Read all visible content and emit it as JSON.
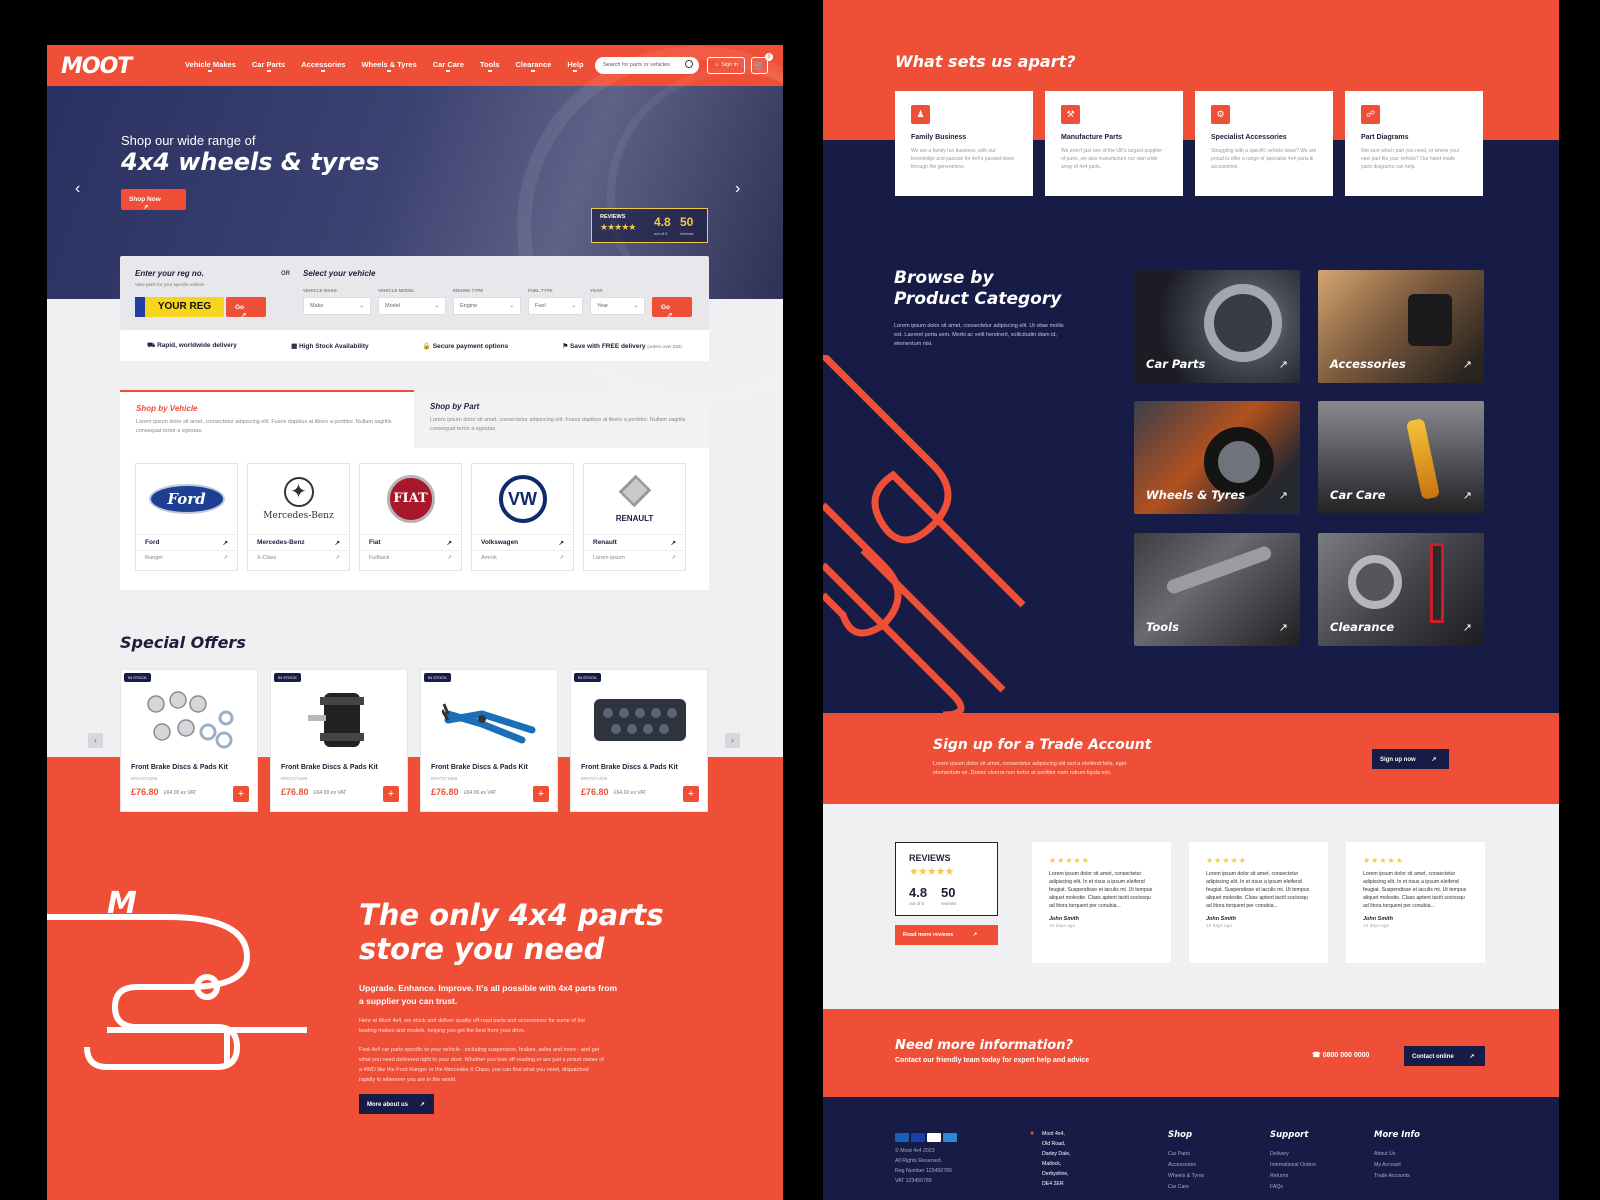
{
  "header": {
    "logo": "MOOT",
    "nav": [
      "Vehicle Makes",
      "Car Parts",
      "Accessories",
      "Wheels & Tyres",
      "Car Care",
      "Tools",
      "Clearance",
      "Help"
    ],
    "search_placeholder": "Search for parts or vehicles",
    "signin": "Sign in",
    "cart_count": "0"
  },
  "hero": {
    "line1": "Shop our wide range of",
    "line2": "4x4 wheels & tyres",
    "cta": "Shop Now",
    "reviews_brand": "REVIEWS",
    "rating": "4.8",
    "rating_sub": "out of 5",
    "review_count": "50",
    "review_count_sub": "reviews"
  },
  "search": {
    "reg_label": "Enter your reg no.",
    "reg_sub": "View parts for your specific vehicle",
    "reg_plate": "YOUR REG",
    "go": "Go",
    "or": "OR",
    "vehicle_label": "Select your vehicle",
    "fields": [
      {
        "label": "VEHICLE MAKE",
        "value": "Make"
      },
      {
        "label": "VEHICLE MODEL",
        "value": "Model"
      },
      {
        "label": "ENGINE TYPE",
        "value": "Engine"
      },
      {
        "label": "FUEL TYPE",
        "value": "Fuel"
      },
      {
        "label": "YEAR",
        "value": "Year"
      }
    ]
  },
  "benefits": [
    "Rapid, worldwide delivery",
    "High Stock Availability",
    "Secure payment options",
    "Save with FREE delivery"
  ],
  "benefits_note": "(orders over £50)",
  "shop_tabs": [
    {
      "title": "Shop by Vehicle",
      "desc": "Lorem ipsum dolor sit amet, consectetur adipiscing elit. Fusce dapibus at libero a porttitor. Nullam sagittis consequat tortor a egestas."
    },
    {
      "title": "Shop by Part",
      "desc": "Lorem ipsum dolor sit amet, consectetur adipiscing elit. Fusce dapibus at libero a porttitor. Nullam sagittis consequat tortor a egestas."
    }
  ],
  "brands": [
    {
      "name": "Ford",
      "model": "Ranger",
      "logo": "Ford"
    },
    {
      "name": "Mercedes-Benz",
      "model": "X-Class",
      "logo": "Mercedes-Benz"
    },
    {
      "name": "Fiat",
      "model": "Fullback",
      "logo": "FIAT"
    },
    {
      "name": "Volkswagen",
      "model": "Amrok",
      "logo": "VW"
    },
    {
      "name": "Renault",
      "model": "Lorem ipsum",
      "logo": "RENAULT"
    }
  ],
  "special_offers": {
    "title": "Special Offers",
    "badge": "IN STOCK",
    "items": [
      {
        "title": "Front Brake Discs & Pads Kit",
        "sku": "BR07871096",
        "price": "£76.80",
        "ex_vat": "£64.00 ex VAT"
      },
      {
        "title": "Front Brake Discs & Pads Kit",
        "sku": "BR07871096",
        "price": "£76.80",
        "ex_vat": "£64.00 ex VAT"
      },
      {
        "title": "Front Brake Discs & Pads Kit",
        "sku": "BR07871096",
        "price": "£76.80",
        "ex_vat": "£64.00 ex VAT"
      },
      {
        "title": "Front Brake Discs & Pads Kit",
        "sku": "BR07871096",
        "price": "£76.80",
        "ex_vat": "£64.00 ex VAT"
      }
    ]
  },
  "about": {
    "title": "The only 4x4 parts store you need",
    "lead": "Upgrade. Enhance. Improve. It's all possible with 4x4 parts from a supplier you can trust.",
    "p1": "Here at Moot 4x4, we stock and deliver quality off-road parts and accessories for some of the leading makes and models, helping you get the best from your drive.",
    "p2": "Find 4x4 car parts specific to your vehicle - including suspension, brakes, axles and more - and get what you need delivered right to your door. Whether you love off-roading or are just a proud owner of a 4WD like the Ford Ranger or the Mercedes X Class, you can find what you need, dispatched rapidly to wherever you are in the world.",
    "cta": "More about us"
  },
  "apart": {
    "title": "What sets us apart?",
    "items": [
      {
        "title": "Family Business",
        "desc": "We are a family run business, with our knowledge and passion for 4x4's passed down through the generations."
      },
      {
        "title": "Manufacture Parts",
        "desc": "We aren't just one of the UK's largest supplier of parts, we also manufacture our own wide array of 4x4 parts."
      },
      {
        "title": "Specialist Accessories",
        "desc": "Struggling with a specific vehicle issue? We are proud to offer a range of specialist 4x4 parts & accessories."
      },
      {
        "title": "Part Diagrams",
        "desc": "Not sure which part you need, or where your new part fits your vehicle? Our hand-made parts diagrams can help."
      }
    ]
  },
  "browse": {
    "title1": "Browse by",
    "title2": "Product Category",
    "desc": "Lorem ipsum dolor sit amet, consectetur adipiscing elit. Ut vitae mollis est. Laoreet porta sem. Morbi ac velit hendrerit, sollicitudin diam id, elementum nisi.",
    "categories": [
      "Car Parts",
      "Accessories",
      "Wheels & Tyres",
      "Car Care",
      "Tools",
      "Clearance"
    ]
  },
  "trade": {
    "title": "Sign up for a Trade Account",
    "desc": "Lorem ipsum dolor sit amet, consectetur adipiscing elit sed a eleifend felis, eget elementum ex. Donec viverra non tortor at porttitor nam rutrum ligula nisi.",
    "cta": "Sign up now"
  },
  "reviews": {
    "brand": "REVIEWS",
    "rating": "4.8",
    "rating_sub": "out of 5",
    "count": "50",
    "count_sub": "reviews",
    "cta": "Read more reviews",
    "items": [
      {
        "text": "Lorem ipsum dolor sit amet, consectetur adipiscing elit. In et risus a ipsum eleifend feugiat. Suspendisse et iaculis mi. Ut tempus aliquet molestie. Class aptent taciti sociosqu ad litora torquent per conubia...",
        "name": "John Smith",
        "date": "10 days ago"
      },
      {
        "text": "Lorem ipsum dolor sit amet, consectetur adipiscing elit. In et risus a ipsum eleifend feugiat. Suspendisse et iaculis mi. Ut tempus aliquet molestie. Class aptent taciti sociosqu ad litora torquent per conubia...",
        "name": "John Smith",
        "date": "10 days ago"
      },
      {
        "text": "Lorem ipsum dolor sit amet, consectetur adipiscing elit. In et risus a ipsum eleifend feugiat. Suspendisse et iaculis mi. Ut tempus aliquet molestie. Class aptent taciti sociosqu ad litora torquent per conubia...",
        "name": "John Smith",
        "date": "10 days ago"
      }
    ]
  },
  "info": {
    "title": "Need more information?",
    "desc": "Contact our friendly team today for expert help and advice",
    "phone": "0800 000 0000",
    "cta": "Contact online"
  },
  "footer": {
    "copyright": [
      "© Moot 4x4 2023",
      "All Rights Reserved.",
      "Reg Number 123456789",
      "VAT 123456789"
    ],
    "address": [
      "Moot 4x4,",
      "Old Road,",
      "Darley Dale,",
      "Matlock,",
      "Derbyshire,",
      "DE4 2ER"
    ],
    "cols": [
      {
        "title": "Shop",
        "links": [
          "Car Parts",
          "Accessories",
          "Wheels & Tyres",
          "Car Care"
        ]
      },
      {
        "title": "Support",
        "links": [
          "Delivery",
          "International Orders",
          "Returns",
          "FAQs"
        ]
      },
      {
        "title": "More Info",
        "links": [
          "About Us",
          "My Account",
          "Trade Accounts"
        ]
      }
    ]
  },
  "colors": {
    "brand": "#ef4f37",
    "navy": "#161c46",
    "bg": "#f0f0f3",
    "star": "#f2c94c"
  }
}
